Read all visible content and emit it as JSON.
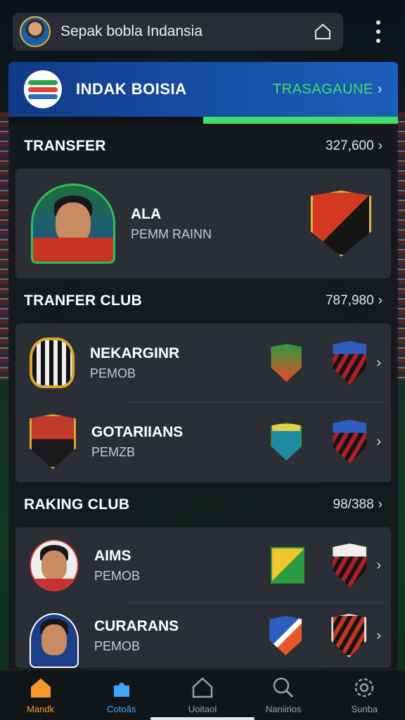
{
  "topbar": {
    "title": "Sepak bobla Indansia"
  },
  "hero": {
    "title": "INDAK BOISIA",
    "link": "TRASAGAUNE",
    "progress_fraction": 0.5
  },
  "transfer": {
    "title": "TRANSFER",
    "count": "327,600",
    "player": {
      "name": "ALA",
      "sub": "PEMM RAINN"
    }
  },
  "transfer_club": {
    "title": "TRANFER CLUB",
    "count": "787,980",
    "rows": [
      {
        "name": "NEKARGINR",
        "sub": "PEMOB"
      },
      {
        "name": "GOTARIIANS",
        "sub": "PEMZB"
      }
    ]
  },
  "ranking_club": {
    "title": "RAKING CLUB",
    "count": "98/388",
    "rows": [
      {
        "name": "AIMS",
        "sub": "PEMOB"
      },
      {
        "name": "CURARANS",
        "sub": "PEMOB"
      }
    ]
  },
  "nav": {
    "items": [
      {
        "label": "Mandk",
        "icon": "home-icon"
      },
      {
        "label": "Cotoăs",
        "icon": "puzzle-icon"
      },
      {
        "label": "Uoitaol",
        "icon": "house-outline-icon"
      },
      {
        "label": "Naniirios",
        "icon": "search-icon"
      },
      {
        "label": "Sunba",
        "icon": "settings-icon"
      }
    ]
  },
  "colors": {
    "accent_green": "#3fe06a",
    "hero_blue": "#1650a8",
    "nav_home": "#f59a2a",
    "nav_club": "#3fa8ff"
  }
}
